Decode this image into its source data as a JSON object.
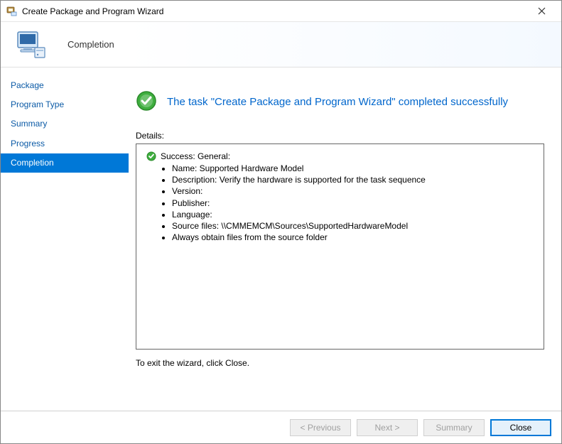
{
  "window": {
    "title": "Create Package and Program Wizard"
  },
  "banner": {
    "title": "Completion"
  },
  "sidebar": {
    "items": [
      {
        "label": "Package",
        "selected": false
      },
      {
        "label": "Program Type",
        "selected": false
      },
      {
        "label": "Summary",
        "selected": false
      },
      {
        "label": "Progress",
        "selected": false
      },
      {
        "label": "Completion",
        "selected": true
      }
    ]
  },
  "main": {
    "success_message": "The task \"Create Package and Program Wizard\" completed successfully",
    "details_label": "Details:",
    "details_header": "Success: General:",
    "details_items": [
      "Name: Supported Hardware Model",
      "Description: Verify the hardware is supported for the task sequence",
      "Version:",
      "Publisher:",
      "Language:",
      "Source files: \\\\CMMEMCM\\Sources\\SupportedHardwareModel",
      "Always obtain files from the source folder"
    ],
    "exit_note": "To exit the wizard, click Close."
  },
  "footer": {
    "previous": "< Previous",
    "next": "Next >",
    "summary": "Summary",
    "close": "Close"
  }
}
